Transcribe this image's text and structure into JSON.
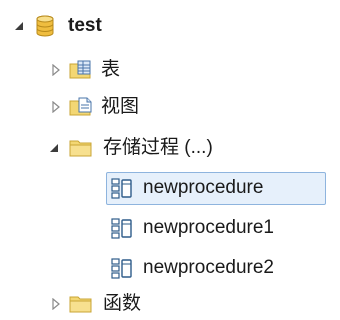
{
  "tree": {
    "root": {
      "label": "test",
      "expanded": true,
      "icon": "database-icon"
    },
    "children": [
      {
        "label": "表",
        "expanded": false,
        "icon": "table-folder-icon"
      },
      {
        "label": "视图",
        "expanded": false,
        "icon": "view-folder-icon"
      },
      {
        "label": "存储过程 (...)",
        "expanded": true,
        "icon": "folder-icon",
        "items": [
          {
            "label": "newprocedure",
            "selected": true,
            "icon": "procedure-icon"
          },
          {
            "label": "newprocedure1",
            "selected": false,
            "icon": "procedure-icon"
          },
          {
            "label": "newprocedure2",
            "selected": false,
            "icon": "procedure-icon"
          }
        ]
      },
      {
        "label": "函数",
        "expanded": false,
        "icon": "folder-icon"
      }
    ]
  },
  "colors": {
    "selection_bg": "#e6f0fb",
    "selection_border": "#8eb4de",
    "folder_yellow": "#f3d774",
    "database_gold": "#e8b640"
  }
}
